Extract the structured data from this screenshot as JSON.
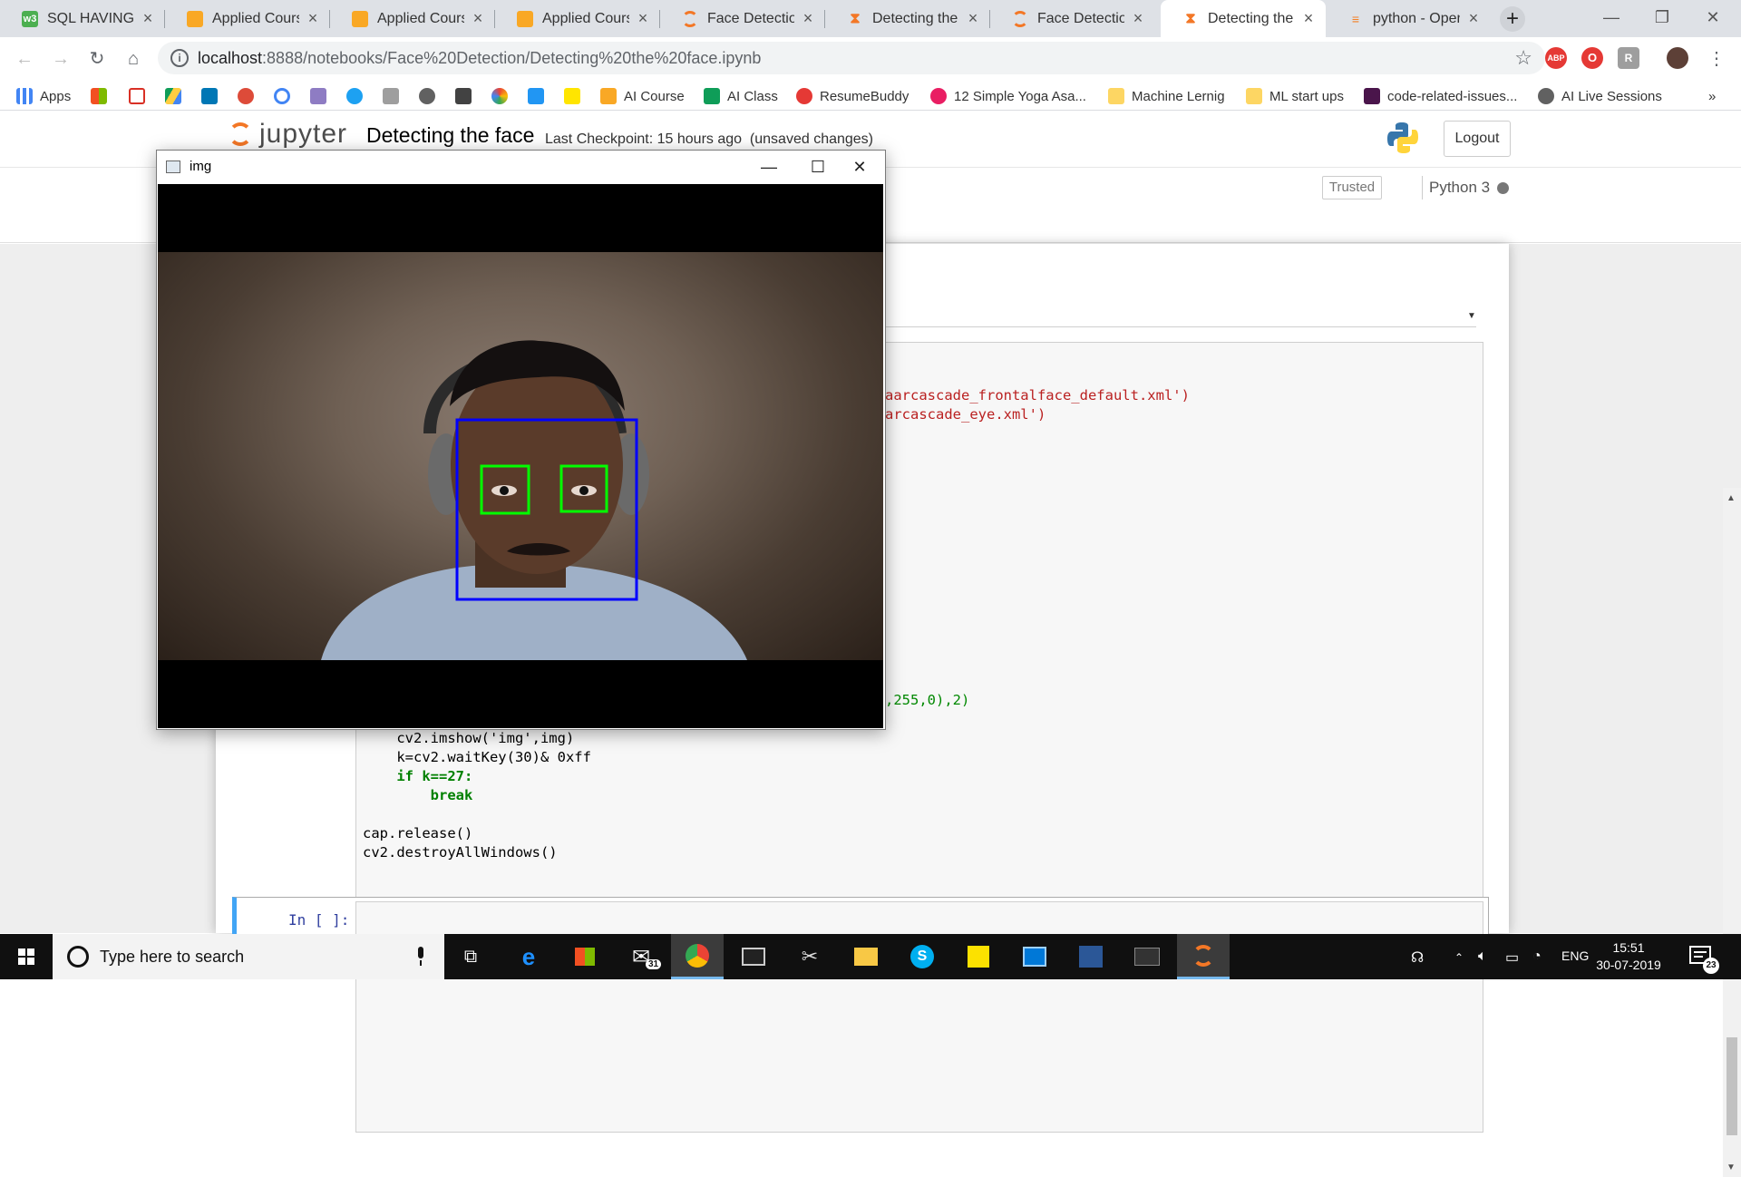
{
  "browser": {
    "tabs": [
      {
        "label": "SQL HAVING Cl",
        "icon": "w3schools-icon",
        "color": "#4caf50"
      },
      {
        "label": "Applied Course",
        "icon": "appliedcourse-icon",
        "color": "#f9a825"
      },
      {
        "label": "Applied Course",
        "icon": "appliedcourse-icon",
        "color": "#f9a825"
      },
      {
        "label": "Applied Course",
        "icon": "appliedcourse-icon",
        "color": "#f9a825"
      },
      {
        "label": "Face Detection",
        "icon": "jupyter-icon",
        "color": "#f37726"
      },
      {
        "label": "Detecting the f",
        "icon": "hourglass-icon",
        "color": "#f37726"
      },
      {
        "label": "Face Detection",
        "icon": "jupyter-icon",
        "color": "#f37726"
      },
      {
        "label": "Detecting the f",
        "icon": "hourglass-icon",
        "color": "#f37726",
        "active": true
      },
      {
        "label": "python - Open",
        "icon": "stackoverflow-icon",
        "color": "#f48024"
      }
    ],
    "url_host": "localhost",
    "url_rest": ":8888/notebooks/Face%20Detection/Detecting%20the%20face.ipynb",
    "extensions": [
      "ABP",
      "O",
      "R"
    ],
    "bookmarks": [
      {
        "label": "Apps",
        "icon": "apps-grid-icon"
      },
      {
        "label": "",
        "icon": "microsoft-icon"
      },
      {
        "label": "",
        "icon": "gmail-icon"
      },
      {
        "label": "",
        "icon": "drive-icon"
      },
      {
        "label": "",
        "icon": "linkedin-icon"
      },
      {
        "label": "",
        "icon": "google-plus-icon"
      },
      {
        "label": "",
        "icon": "google-icon"
      },
      {
        "label": "",
        "icon": "mail-icon"
      },
      {
        "label": "",
        "icon": "twitter-icon"
      },
      {
        "label": "",
        "icon": "page-icon"
      },
      {
        "label": "",
        "icon": "globe-icon"
      },
      {
        "label": "",
        "icon": "bookmark-icon"
      },
      {
        "label": "",
        "icon": "pinwheel-icon"
      },
      {
        "label": "",
        "icon": "filter-icon"
      },
      {
        "label": "",
        "icon": "flipkart-icon"
      },
      {
        "label": "AI Course",
        "icon": "appliedcourse-icon"
      },
      {
        "label": "AI Class",
        "icon": "classroom-icon"
      },
      {
        "label": "ResumeBuddy",
        "icon": "resumebuddy-icon"
      },
      {
        "label": "12 Simple Yoga Asa...",
        "icon": "yoga-icon"
      },
      {
        "label": "Machine Lernig",
        "icon": "folder-icon"
      },
      {
        "label": "ML start ups",
        "icon": "folder-icon"
      },
      {
        "label": "code-related-issues...",
        "icon": "slack-icon"
      },
      {
        "label": "AI Live Sessions",
        "icon": "globe-icon"
      }
    ],
    "more_bookmarks": "»"
  },
  "jupyter": {
    "logo_text": "jupyter",
    "notebook_title": "Detecting the face",
    "checkpoint": "Last Checkpoint: 15 hours ago",
    "unsaved": "(unsaved changes)",
    "logout_label": "Logout",
    "trusted_label": "Trusted",
    "kernel_name": "Python 3",
    "next_prompt": "In [ ]:"
  },
  "code_visible": {
    "line_face_cascade_tail": "aarcascade_frontalface_default.xml')",
    "line_eye_cascade_tail": "arcascade_eye.xml')",
    "line_rect_tail": ",255,0),2)",
    "line_imshow": "    cv2.imshow('img',img)",
    "line_waitkey": "    k=cv2.waitKey(30)& 0xff",
    "line_if": "    if k==27:",
    "line_break": "        break",
    "line_release": "cap.release()",
    "line_destroy": "cv2.destroyAllWindows()"
  },
  "opencv_window": {
    "title": "img",
    "face_box_color": "#0000ff",
    "eye_box_color": "#00ff00"
  },
  "taskbar": {
    "search_placeholder": "Type here to search",
    "mail_badge": "31",
    "language": "ENG",
    "time": "15:51",
    "date": "30-07-2019",
    "notification_count": "23"
  }
}
